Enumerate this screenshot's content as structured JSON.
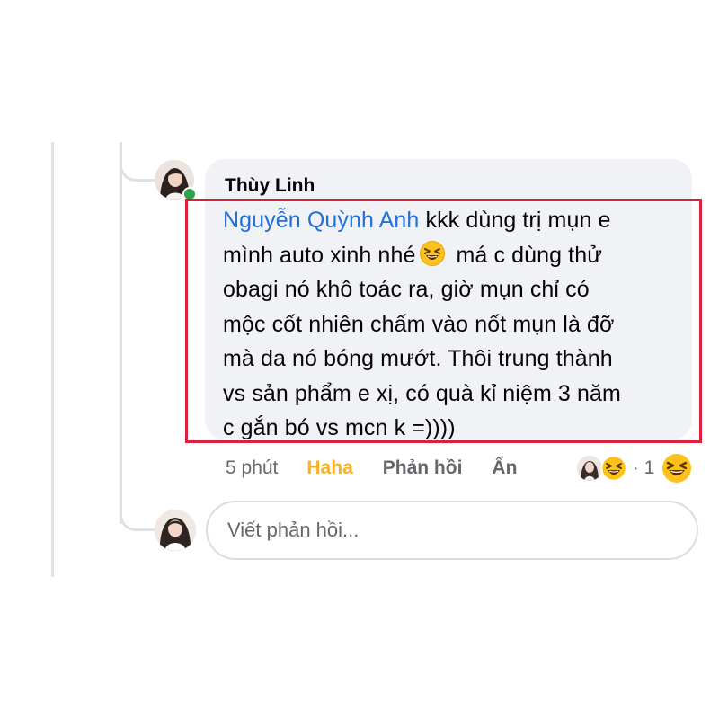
{
  "comment": {
    "author": "Thùy Linh",
    "mention": "Nguyễn Quỳnh Anh",
    "text_line1_after_mention": " kkk dùng trị mụn e",
    "text_line2_before_emoji": "mình auto xinh nhé",
    "emoji": "laughing-squinting-face-icon",
    "text_line2_after_emoji": " má c dùng thử",
    "text_line3": "obagi nó khô toác ra, giờ mụn chỉ có",
    "text_line4": "mộc cốt nhiên chấm vào nốt mụn là đỡ",
    "text_line5": "mà da nó bóng mướt. Thôi trung thành",
    "text_line6": "vs sản phẩm e xị, có quà kỉ niệm 3 năm",
    "text_line7": "c gắn bó vs mcn k =))))"
  },
  "actions": {
    "time": "5 phút",
    "haha": "Haha",
    "reply": "Phản hồi",
    "hide": "Ẩn"
  },
  "reactions": {
    "separator": "·",
    "count": "1"
  },
  "reply_box": {
    "placeholder": "Viết phản hồi..."
  },
  "colors": {
    "mention": "#216fdb",
    "haha": "#f7b125",
    "highlight": "#d9223b",
    "bubble": "#f0f2f5"
  }
}
